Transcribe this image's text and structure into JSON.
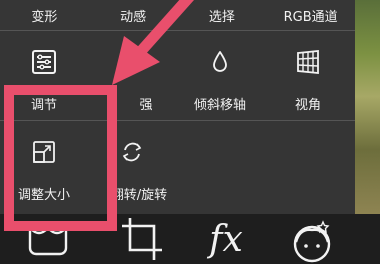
{
  "top_row": [
    "变形",
    "动感",
    "选择",
    "RGB通道"
  ],
  "tools": {
    "adjust": "调节",
    "enhance": "强",
    "tilt_shift": "倾斜移轴",
    "perspective": "视角",
    "resize": "调整大小",
    "flip_rotate": "翻转/旋转"
  },
  "bottom_bar": {
    "fx_label": "fx"
  },
  "colors": {
    "highlight": "#e94f6c",
    "background": "#353535",
    "text": "#f2f2f2"
  }
}
